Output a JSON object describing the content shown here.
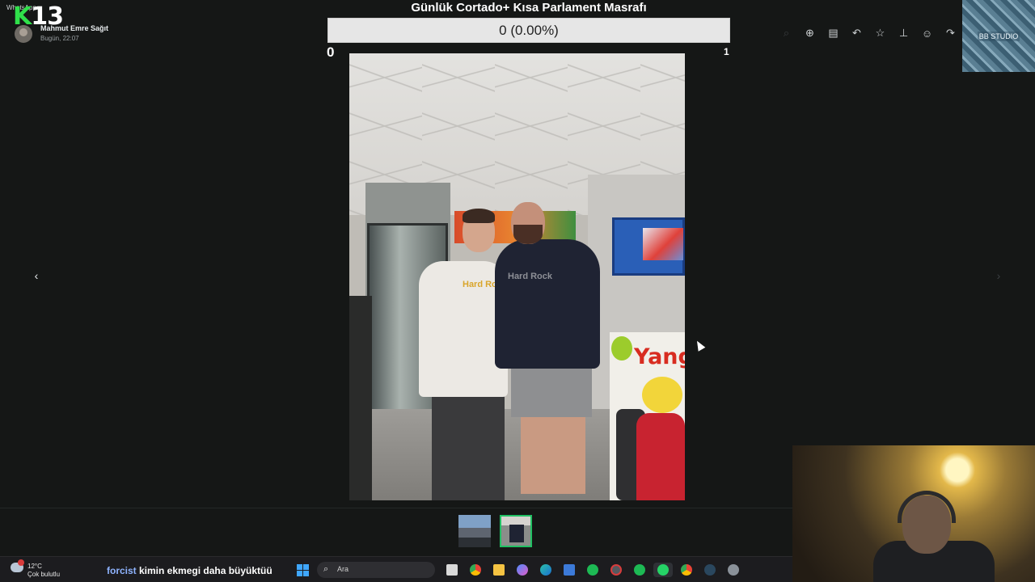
{
  "overlay": {
    "brand_letter": "K",
    "brand_number": "13",
    "app_label": "WhatsApp"
  },
  "message": {
    "sender": "Mahmut Emre Sağıt",
    "time": "Bugün, 22:07"
  },
  "poll": {
    "title": "Günlük Cortado+ Kısa Parlament Masrafı",
    "progress_text": "0 (0.00%)",
    "min_label": "0",
    "max_label": "1",
    "progress_fraction": 0.0
  },
  "toolbar": {
    "icons": [
      "search-icon",
      "zoom-in-icon",
      "chat-bubble-icon",
      "reply-icon",
      "star-icon",
      "pin-icon",
      "emoji-icon",
      "forward-icon"
    ]
  },
  "cover": {
    "label": "BB STUDIO"
  },
  "photo": {
    "brand_text_1": "Hard Rock",
    "brand_text_2": "Hard Rock",
    "fridge_text": "Yang"
  },
  "thumbnails": [
    {
      "label": "thumbnail 1",
      "selected": false
    },
    {
      "label": "thumbnail 2",
      "selected": true
    }
  ],
  "taskbar": {
    "weather_temp": "12°C",
    "weather_cond": "Çok bulutlu",
    "chat_user": "forcist",
    "chat_message": "kimin ekmegi daha büyüktüü",
    "search_placeholder": "Ara",
    "apps": [
      "task-view-icon",
      "chrome-icon",
      "file-explorer-icon",
      "copilot-icon",
      "edge-icon",
      "store-icon",
      "spotify-icon",
      "steam-notify-icon",
      "spotify-icon-2",
      "whatsapp-icon",
      "chrome-icon-2",
      "steam-icon",
      "settings-icon"
    ]
  },
  "colors": {
    "background": "#151716",
    "accent_green": "#21c063",
    "poll_bar": "#e6e6e6"
  }
}
